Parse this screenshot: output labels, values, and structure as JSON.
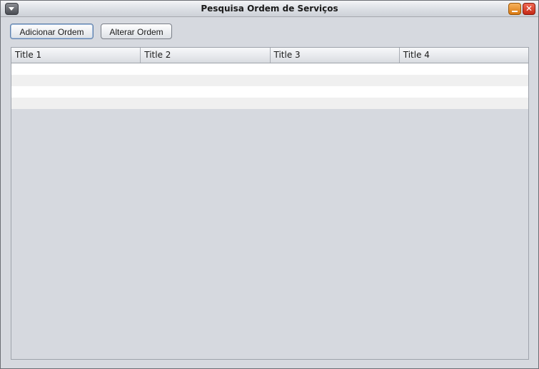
{
  "window": {
    "title": "Pesquisa Ordem de Serviços",
    "close_glyph": "✕"
  },
  "toolbar": {
    "add_label": "Adicionar Ordem",
    "edit_label": "Alterar Ordem"
  },
  "table": {
    "columns": [
      "Title 1",
      "Title 2",
      "Title 3",
      "Title 4"
    ],
    "rows": [
      [
        "",
        "",
        "",
        ""
      ],
      [
        "",
        "",
        "",
        ""
      ],
      [
        "",
        "",
        "",
        ""
      ],
      [
        "",
        "",
        "",
        ""
      ]
    ]
  },
  "icons": {
    "system_menu": "chevron-down-icon",
    "minimize": "minimize-icon",
    "close": "close-icon"
  }
}
